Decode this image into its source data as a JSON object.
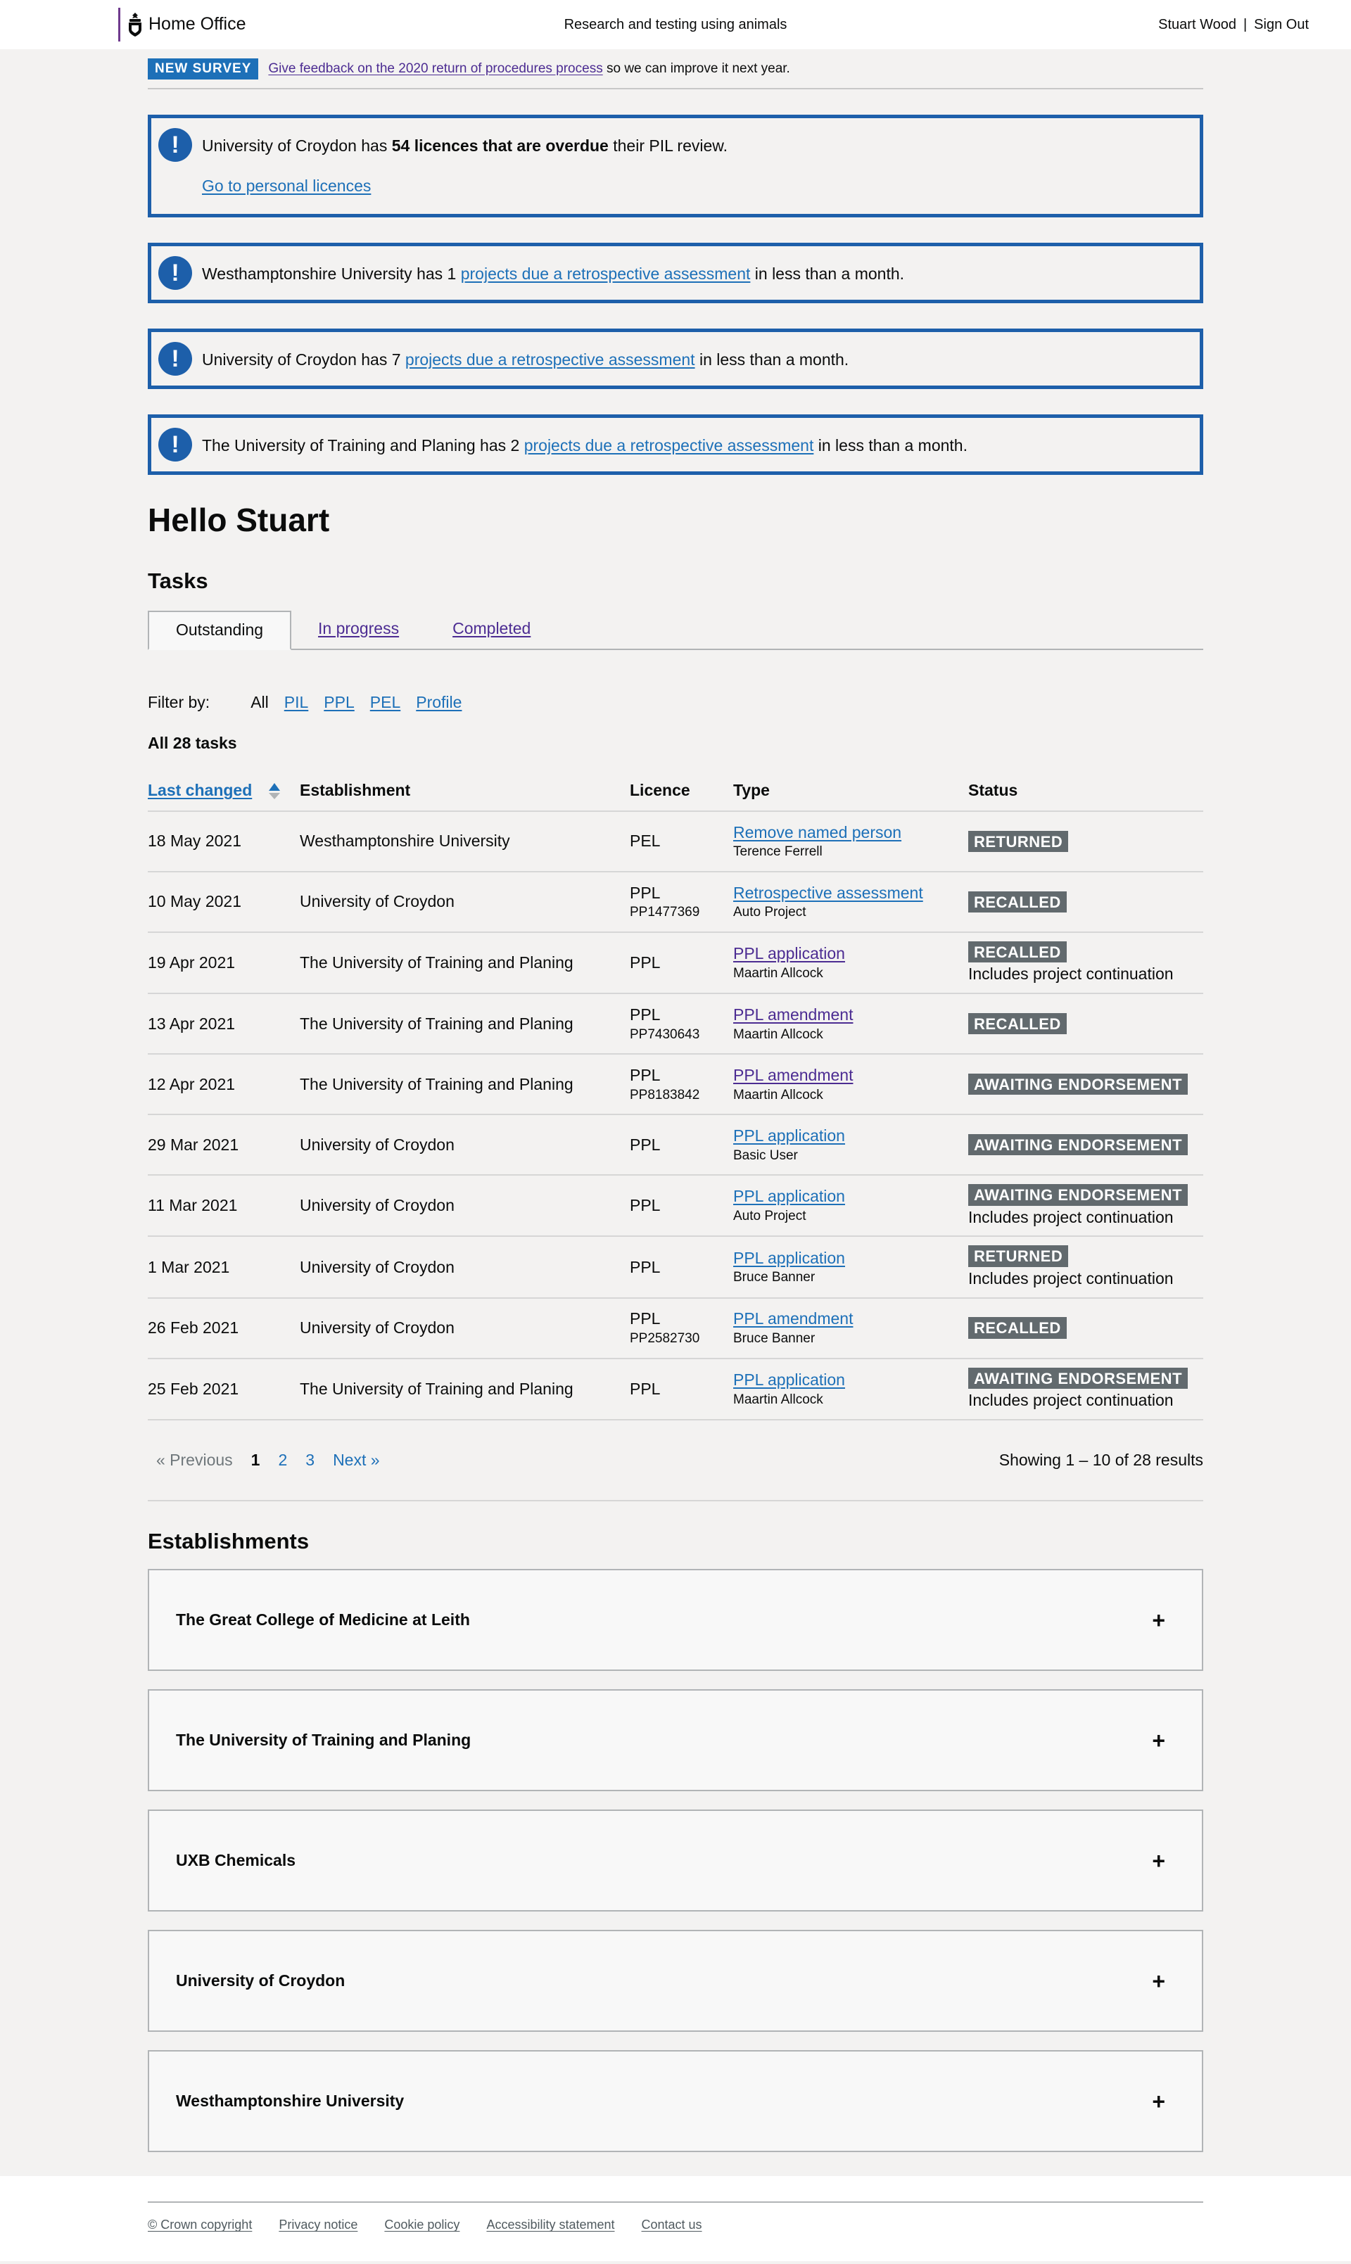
{
  "header": {
    "logo_text": "Home Office",
    "service_name": "Research and testing using animals",
    "user_name": "Stuart Wood",
    "separator": "|",
    "sign_out": "Sign Out"
  },
  "survey": {
    "tag": "NEW SURVEY",
    "link": "Give feedback on the 2020 return of procedures process",
    "suffix": " so we can improve it next year."
  },
  "alerts": [
    {
      "pre": "University of Croydon has ",
      "bold": "54 licences that are overdue",
      "post": " their PIL review.",
      "sub_link": "Go to personal licences"
    },
    {
      "pre": "Westhamptonshire University has 1 ",
      "link": "projects due a retrospective assessment",
      "post": " in less than a month."
    },
    {
      "pre": "University of Croydon has 7 ",
      "link": "projects due a retrospective assessment",
      "post": " in less than a month."
    },
    {
      "pre": "The University of Training and Planing has 2 ",
      "link": "projects due a retrospective assessment",
      "post": " in less than a month."
    }
  ],
  "greeting": "Hello Stuart",
  "tasks_heading": "Tasks",
  "tabs": [
    "Outstanding",
    "In progress",
    "Completed"
  ],
  "filter": {
    "label": "Filter by:",
    "options": [
      "All",
      "PIL",
      "PPL",
      "PEL",
      "Profile"
    ]
  },
  "task_count": "All 28 tasks",
  "table": {
    "headers": [
      "Last changed",
      "Establishment",
      "Licence",
      "Type",
      "Status"
    ],
    "rows": [
      {
        "date": "18 May 2021",
        "establishment": "Westhamptonshire University",
        "licence": "PEL",
        "licence_no": "",
        "type": "Remove named person",
        "person": "Terence Ferrell",
        "status": "RETURNED",
        "note": ""
      },
      {
        "date": "10 May 2021",
        "establishment": "University of Croydon",
        "licence": "PPL",
        "licence_no": "PP1477369",
        "type": "Retrospective assessment",
        "person": "Auto Project",
        "status": "RECALLED",
        "note": ""
      },
      {
        "date": "19 Apr 2021",
        "establishment": "The University of Training and Planing",
        "licence": "PPL",
        "licence_no": "",
        "type": "PPL application",
        "person": "Maartin Allcock",
        "status": "RECALLED",
        "note": "Includes project continuation"
      },
      {
        "date": "13 Apr 2021",
        "establishment": "The University of Training and Planing",
        "licence": "PPL",
        "licence_no": "PP7430643",
        "type": "PPL amendment",
        "person": "Maartin Allcock",
        "status": "RECALLED",
        "note": ""
      },
      {
        "date": "12 Apr 2021",
        "establishment": "The University of Training and Planing",
        "licence": "PPL",
        "licence_no": "PP8183842",
        "type": "PPL amendment",
        "person": "Maartin Allcock",
        "status": "AWAITING ENDORSEMENT",
        "note": ""
      },
      {
        "date": "29 Mar 2021",
        "establishment": "University of Croydon",
        "licence": "PPL",
        "licence_no": "",
        "type": "PPL application",
        "person": "Basic User",
        "status": "AWAITING ENDORSEMENT",
        "note": ""
      },
      {
        "date": "11 Mar 2021",
        "establishment": "University of Croydon",
        "licence": "PPL",
        "licence_no": "",
        "type": "PPL application",
        "person": "Auto Project",
        "status": "AWAITING ENDORSEMENT",
        "note": "Includes project continuation"
      },
      {
        "date": "1 Mar 2021",
        "establishment": "University of Croydon",
        "licence": "PPL",
        "licence_no": "",
        "type": "PPL application",
        "person": "Bruce Banner",
        "status": "RETURNED",
        "note": "Includes project continuation"
      },
      {
        "date": "26 Feb 2021",
        "establishment": "University of Croydon",
        "licence": "PPL",
        "licence_no": "PP2582730",
        "type": "PPL amendment",
        "person": "Bruce Banner",
        "status": "RECALLED",
        "note": ""
      },
      {
        "date": "25 Feb 2021",
        "establishment": "The University of Training and Planing",
        "licence": "PPL",
        "licence_no": "",
        "type": "PPL application",
        "person": "Maartin Allcock",
        "status": "AWAITING ENDORSEMENT",
        "note": "Includes project continuation"
      }
    ]
  },
  "pagination": {
    "previous": "« Previous",
    "pages": [
      "1",
      "2",
      "3"
    ],
    "next": "Next »",
    "showing": "Showing 1 – 10 of 28 results"
  },
  "establishments_heading": "Establishments",
  "establishments": [
    "The Great College of Medicine at Leith",
    "The University of Training and Planing",
    "UXB Chemicals",
    "University of Croydon",
    "Westhamptonshire University"
  ],
  "accordion_icon": "+",
  "footer": {
    "links": [
      "© Crown copyright",
      "Privacy notice",
      "Cookie policy",
      "Accessibility statement",
      "Contact us"
    ]
  },
  "colors": {
    "link": "#1d70b8",
    "visited": "#4c2c92",
    "alert_border": "#1d5faa",
    "status_tag": "#626a6e"
  }
}
